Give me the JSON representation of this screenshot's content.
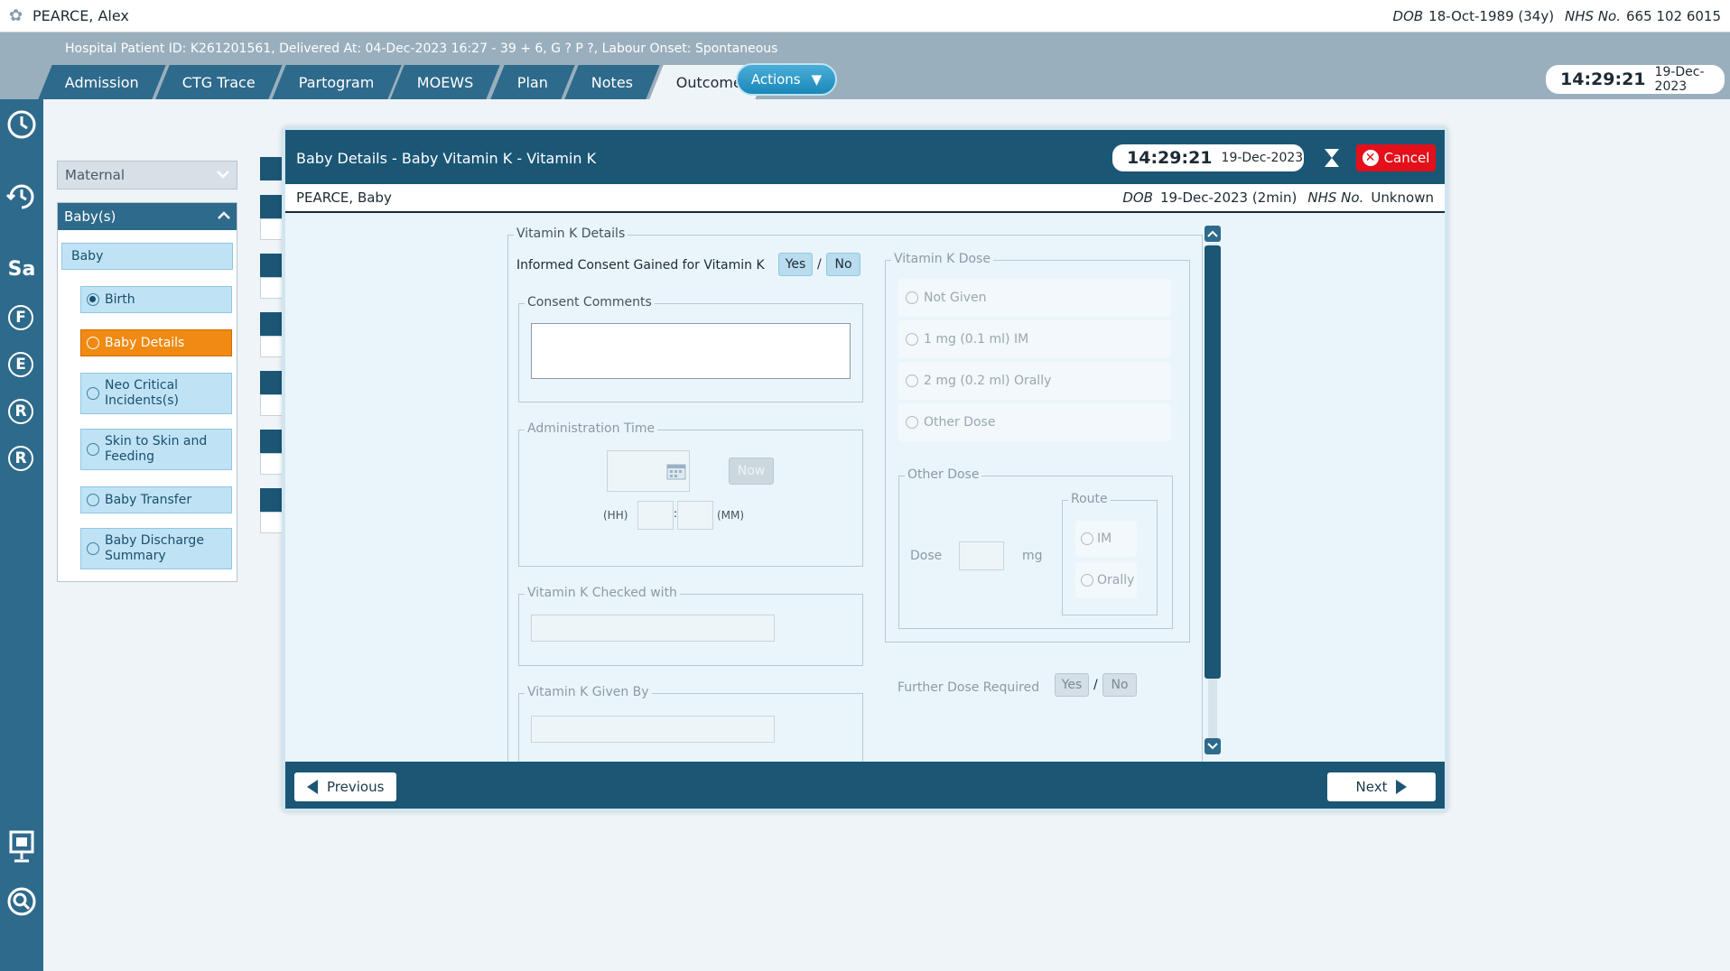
{
  "topbar": {
    "patient_name": "PEARCE, Alex",
    "dob_label": "DOB",
    "dob_value": "18-Oct-1989 (34y)",
    "nhs_label": "NHS No.",
    "nhs_value": "665 102 6015"
  },
  "header": {
    "hospital_info": "Hospital Patient ID: K261201561, Delivered At: 04-Dec-2023 16:27 - 39 + 6, G ? P ?,   Labour Onset: Spontaneous",
    "tabs": [
      {
        "label": "Admission"
      },
      {
        "label": "CTG Trace"
      },
      {
        "label": "Partogram"
      },
      {
        "label": "MOEWS"
      },
      {
        "label": "Plan"
      },
      {
        "label": "Notes"
      },
      {
        "label": "Outcome"
      }
    ],
    "actions_label": "Actions",
    "clock_time": "14:29:21",
    "clock_date": "19-Dec-2023"
  },
  "rail": {
    "letters": [
      "Sa",
      "F",
      "E",
      "R",
      "R"
    ]
  },
  "leftnav": {
    "maternal_label": "Maternal",
    "babys_label": "Baby(s)",
    "baby_label": "Baby",
    "items": [
      {
        "label": "Birth"
      },
      {
        "label": "Baby Details"
      },
      {
        "label": "Neo Critical Incidents(s)"
      },
      {
        "label": "Skin to Skin and Feeding"
      },
      {
        "label": "Baby Transfer"
      },
      {
        "label": "Baby Discharge Summary"
      }
    ]
  },
  "dialog": {
    "title": "Baby Details - Baby Vitamin K - Vitamin K",
    "clock_time": "14:29:21",
    "clock_date": "19-Dec-2023",
    "cancel_label": "Cancel",
    "baby_name": "PEARCE, Baby",
    "dob_label": "DOB",
    "dob_value": "19-Dec-2023 (2min)",
    "nhs_label": "NHS No.",
    "nhs_value": "Unknown",
    "previous_label": "Previous",
    "next_label": "Next"
  },
  "form": {
    "details_legend": "Vitamin K Details",
    "consent_label": "Informed Consent Gained for Vitamin K",
    "yes": "Yes",
    "no": "No",
    "slash": "/",
    "consent_comments_legend": "Consent Comments",
    "admin_time_legend": "Administration Time",
    "now_label": "Now",
    "hh_label": "(HH)",
    "mm_label": "(MM)",
    "time_sep": ":",
    "checked_with_legend": "Vitamin K Checked with",
    "given_by_legend": "Vitamin K Given By",
    "dose_legend": "Vitamin K Dose",
    "dose_options": [
      {
        "label": "Not Given"
      },
      {
        "label": "1 mg (0.1 ml) IM"
      },
      {
        "label": "2 mg (0.2 ml) Orally"
      },
      {
        "label": "Other Dose"
      }
    ],
    "other_dose_legend": "Other Dose",
    "dose_label": "Dose",
    "mg_label": "mg",
    "route_legend": "Route",
    "route_options": [
      {
        "label": "IM"
      },
      {
        "label": "Orally"
      }
    ],
    "further_dose_label": "Further Dose Required"
  }
}
